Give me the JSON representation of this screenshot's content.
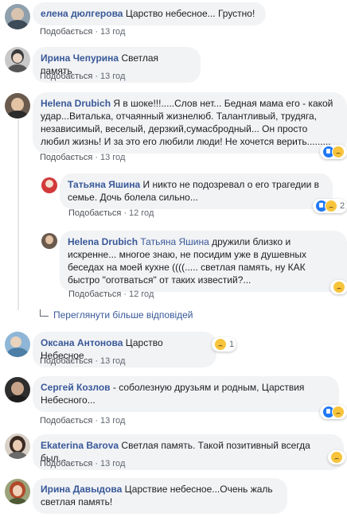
{
  "comments": [
    {
      "author": "елена дюлгерова",
      "text": "Царство небесное... Грустно!",
      "like": "Подобається",
      "time": "13 год"
    },
    {
      "author": "Ирина Чепурина",
      "text": "Светлая память",
      "like": "Подобається",
      "time": "13 год"
    },
    {
      "author": "Helena Drubich",
      "text": "Я в шоке!!!.....Слов нет... Бедная мама его - какой удар...Виталька, отчаянный жизнелюб. Талантливый, трудяга, независимый, веселый, дерзкий,сумасбродный... Он просто любил жизнь! И за это его любили люди! Не хочется верить.........",
      "like": "Подобається",
      "time": "13 год"
    },
    {
      "author": "Татьяна Яшина",
      "text": "И никто не подозревал о его трагедии в семье. Дочь болела сильно...",
      "like": "Подобається",
      "time": "12 год",
      "react_count": "2"
    },
    {
      "author": "Helena Drubich",
      "mention": "Татьяна Яшина",
      "text": "дружили близко и искренне... многое знаю, не посидим уже в душевных беседах на моей кухне ((((..... светлая память, ну КАК быстро \"оготваться\" от таких известий?...",
      "like": "Подобається",
      "time": "12 год"
    },
    {
      "author": "Оксана Антонова",
      "text": "Царство Небесное",
      "like": "Подобається",
      "time": "13 год",
      "react_count": "1"
    },
    {
      "author": "Сергей Козлов",
      "text": "- соболезную друзьям и родным, Царствия Небесного...",
      "like": "Подобається",
      "time": "13 год"
    },
    {
      "author": "Ekaterina Barova",
      "text": "Светлая память. Такой позитивный всегда был...",
      "like": "Подобається",
      "time": "13 год"
    },
    {
      "author": "Ирина Давыдова",
      "text": "Царствие небесное...Очень жаль светлая память!",
      "like": "Подобається",
      "time": "13 год"
    }
  ],
  "more_replies": "Переглянути більше відповідей",
  "colors": {
    "link": "#385898",
    "bubble": "#f2f3f5",
    "meta": "#606770",
    "like_blue": "#2078f4",
    "sad_yellow": "#f7c43c"
  }
}
